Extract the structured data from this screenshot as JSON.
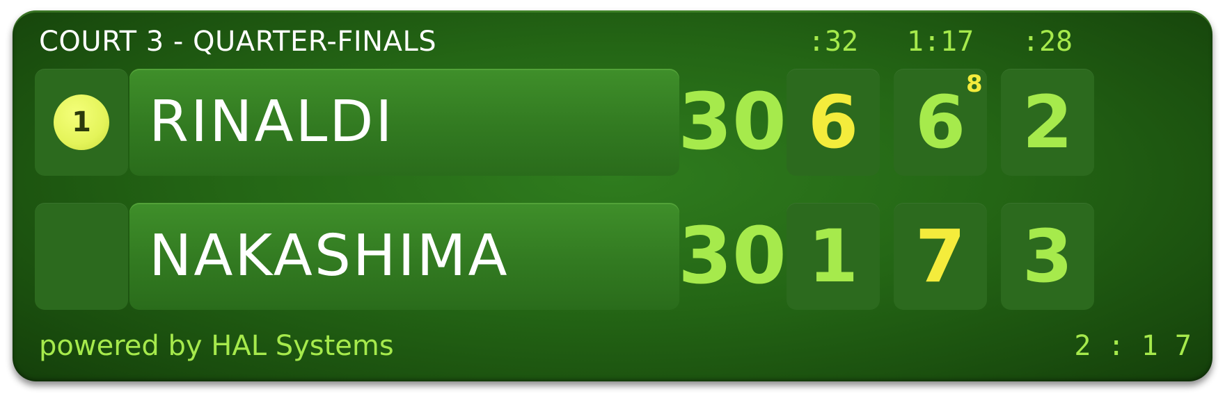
{
  "header": {
    "title": "COURT 3 - QUARTER-FINALS",
    "set_times": [
      ":32",
      "1:17",
      ":28"
    ]
  },
  "server_indicator": {
    "label": "1",
    "icon": "tennis-ball-icon",
    "color": "#e4f45a"
  },
  "players": [
    {
      "name": "RINALDI",
      "points": "30",
      "sets": [
        {
          "games": "6",
          "won": true,
          "tiebreak": ""
        },
        {
          "games": "6",
          "won": false,
          "tiebreak": "8"
        },
        {
          "games": "2",
          "won": false,
          "tiebreak": ""
        }
      ]
    },
    {
      "name": "NAKASHIMA",
      "points": "30",
      "sets": [
        {
          "games": "1",
          "won": false,
          "tiebreak": ""
        },
        {
          "games": "7",
          "won": true,
          "tiebreak": ""
        },
        {
          "games": "3",
          "won": false,
          "tiebreak": ""
        }
      ]
    }
  ],
  "footer": {
    "powered_by": "powered by HAL Systems",
    "match_time": "2 : 1 7"
  },
  "colors": {
    "background": "#246615",
    "score_green": "#a6ea4c",
    "highlight_yellow": "#f4ec3c",
    "text_white": "#ffffff"
  }
}
